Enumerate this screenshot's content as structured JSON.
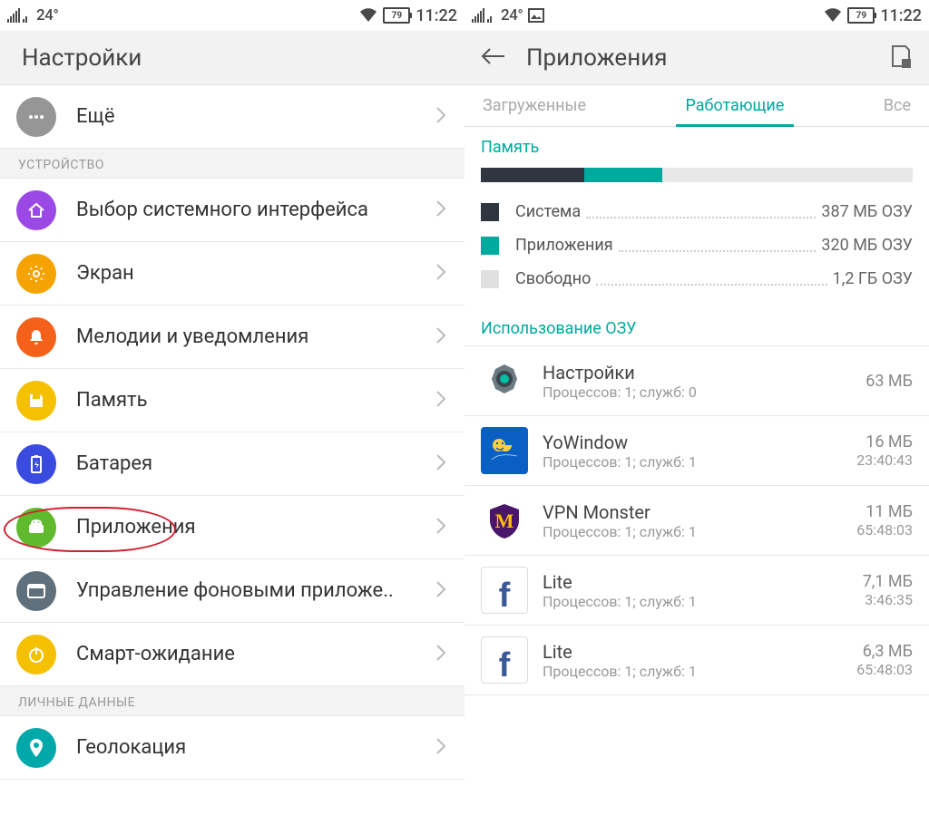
{
  "statusbar": {
    "temp": "24°",
    "battery": "79",
    "clock": "11:22"
  },
  "left": {
    "title": "Настройки",
    "more": "Ещё",
    "section_device": "УСТРОЙСТВО",
    "items": {
      "home_ui": "Выбор системного интерфейса",
      "screen": "Экран",
      "sound": "Мелодии и уведомления",
      "memory": "Память",
      "battery": "Батарея",
      "apps": "Приложения",
      "bg": "Управление фоновыми приложе..",
      "smart": "Смарт-ожидание"
    },
    "section_personal": "ЛИЧНЫЕ ДАННЫЕ",
    "geo": "Геолокация"
  },
  "right": {
    "title": "Приложения",
    "tabs": {
      "downloaded": "Загруженные",
      "running": "Работающие",
      "all": "Все"
    },
    "memory": {
      "label": "Память",
      "pct_system": 24,
      "pct_apps": 18,
      "rows": {
        "system": {
          "label": "Система",
          "value": "387 МБ ОЗУ"
        },
        "apps": {
          "label": "Приложения",
          "value": "320 МБ ОЗУ"
        },
        "free": {
          "label": "Свободно",
          "value": "1,2 ГБ ОЗУ"
        }
      }
    },
    "ram_usage_title": "Использование ОЗУ",
    "apps": [
      {
        "name": "Настройки",
        "sub": "Процессов: 1; служб: 0",
        "size": "63 МБ",
        "time": ""
      },
      {
        "name": "YoWindow",
        "sub": "Процессов: 1; служб: 1",
        "size": "16 МБ",
        "time": "23:40:43"
      },
      {
        "name": "VPN Monster",
        "sub": "Процессов: 1; служб: 1",
        "size": "11 МБ",
        "time": "65:48:03"
      },
      {
        "name": "Lite",
        "sub": "Процессов: 1; служб: 1",
        "size": "7,1 МБ",
        "time": "3:46:35"
      },
      {
        "name": "Lite",
        "sub": "Процессов: 1; служб: 1",
        "size": "6,3 МБ",
        "time": "65:48:03"
      }
    ]
  }
}
